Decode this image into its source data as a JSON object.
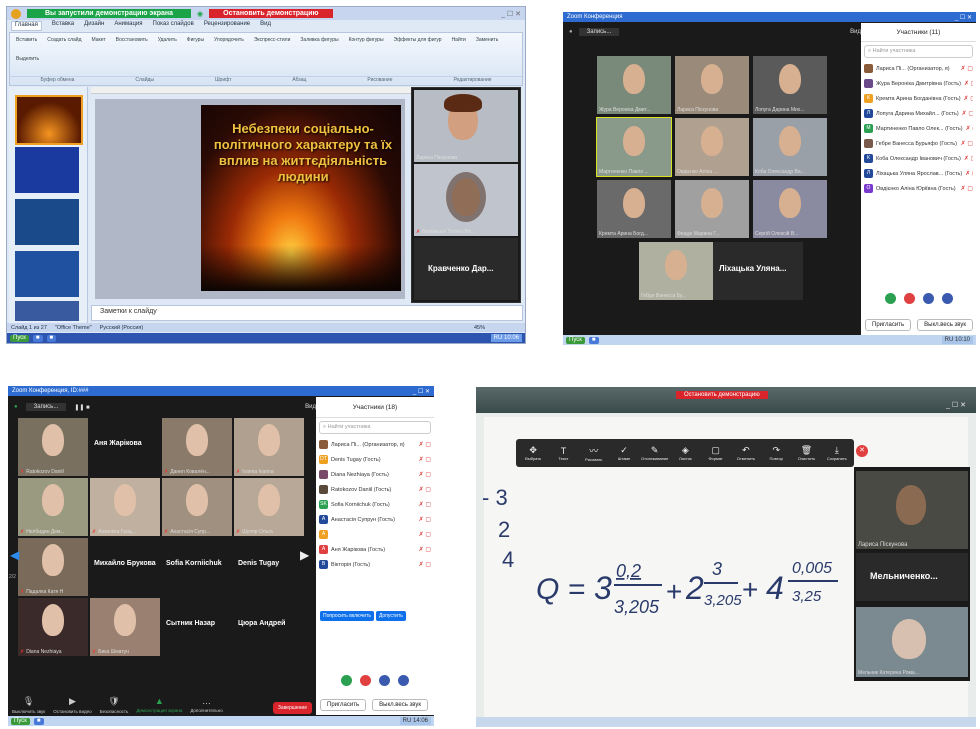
{
  "colors": {
    "ppt_title_bar": "#24399b",
    "demo_green": "#1aa447",
    "stop_red": "#d9242c",
    "zoom_dark": "#1a1a1a",
    "zoom_blue": "#0e71eb",
    "slide_gold": "#f0c040"
  },
  "q1": {
    "demo_banner": "Вы запустили демонстрацию экрана",
    "stop_demo": "Остановить демонстрацию",
    "ribbon_tabs": [
      "Главная",
      "Вставка",
      "Дизайн",
      "Анимация",
      "Показ слайдов",
      "Рецензирование",
      "Вид"
    ],
    "ribbon_groups": [
      "Буфер обмена",
      "Слайды",
      "Шрифт",
      "Абзац",
      "Рисование",
      "Редактирование"
    ],
    "ribbon_buttons": [
      "Вставить",
      "Создать слайд",
      "Макет",
      "Восстановить",
      "Удалить",
      "Фигуры",
      "Упорядочить",
      "Экспресс-стили",
      "Заливка фигуры",
      "Контур фигуры",
      "Эффекты для фигур",
      "Найти",
      "Заменить",
      "Выделить"
    ],
    "slide_title": "Небезпеки соціально-політичного характеру та їх вплив на життєдіяльність людини",
    "participant1": "Лариса Піскунова",
    "participant2": "Веремьюк Тетяна Віт...",
    "participant3": "Кравченко Дар...",
    "notes": "Заметки к слайду",
    "status": "Слайд 1 из 27",
    "theme": "\"Office Theme\"",
    "lang": "Русский (Россия)",
    "zoom": "45%",
    "start": "Пуск",
    "lang_tray": "RU",
    "time": "10:06"
  },
  "q2": {
    "title": "Zoom Конференция",
    "record": "Запись...",
    "view": "Вид",
    "participants_header": "Участники (11)",
    "search": "Найти участника",
    "tiles": [
      "Жура Вероніка Дмит...",
      "Лариса Піскунова",
      "Лопуга Дарина Мих...",
      "Мартиненко Павло ...",
      "Овдієнко Аліна ...",
      "Коба Олександр Ва...",
      "Кремта Арина Богд...",
      "Фещук Марина Г...",
      "Сергій Олексій В...",
      "Гебре Ванесса Бу...",
      "Ліхацька Уляна..."
    ],
    "participants": [
      {
        "name": "Лариса Пі... (Организатор, я)",
        "color": "#8a5a3a",
        "letter": ""
      },
      {
        "name": "Жура Вероніка Дмитрівна (Гость)",
        "color": "#6a4a8a",
        "letter": ""
      },
      {
        "name": "Кремта Арина Богданівна (Гость)",
        "color": "#f0a020",
        "letter": "К"
      },
      {
        "name": "Лопуга Дарина Михайл... (Гость)",
        "color": "#234a9a",
        "letter": "Л"
      },
      {
        "name": "Мартиненко Павло Олек... (Гость)",
        "color": "#2aa050",
        "letter": "М"
      },
      {
        "name": "Гебре Ванесса Бурьяфо (Гость)",
        "color": "#7a5a4a",
        "letter": ""
      },
      {
        "name": "Коба Олександр Іванович (Гость)",
        "color": "#234a9a",
        "letter": "К"
      },
      {
        "name": "Ліхацька Уляна Ярослав... (Гость)",
        "color": "#234a9a",
        "letter": "Л"
      },
      {
        "name": "Овдієнко Аліна Юріївна (Гость)",
        "color": "#7a3ad0",
        "letter": "О"
      }
    ],
    "invite": "Пригласить",
    "mute_all": "Выкл.весь звук",
    "start": "Пуск",
    "tray_lang": "RU",
    "time": "10:10"
  },
  "q3": {
    "title": "Zoom Конференция, ID:###",
    "record": "Запись...",
    "view": "Вид",
    "participants_header": "Участники (18)",
    "search": "Найти участника",
    "tiles": [
      {
        "name": "Ratokozov Daniil",
        "big": "",
        "video": true
      },
      {
        "name": "",
        "big": "Аня Жарікова",
        "video": false
      },
      {
        "name": "Данил Ковалён...",
        "big": "",
        "video": true
      },
      {
        "name": "Ivanna Ivanna",
        "big": "",
        "video": true
      },
      {
        "name": "Нелбидин Дем...",
        "big": "",
        "video": true
      },
      {
        "name": "Анжеліка Гаоц...",
        "big": "",
        "video": true
      },
      {
        "name": "Анастасія Супр...",
        "big": "",
        "video": true
      },
      {
        "name": "Шуляр Ольга",
        "big": "",
        "video": true
      },
      {
        "name": "Падалка Катя Н",
        "big": "",
        "video": true
      },
      {
        "name": "",
        "big": "Михайло Брукова",
        "video": false
      },
      {
        "name": "",
        "big": "Sofia Korniichuk",
        "video": false
      },
      {
        "name": "",
        "big": "Denis Tugay",
        "video": false
      },
      {
        "name": "Diana Nezhiaya",
        "big": "",
        "video": true
      },
      {
        "name": "Бикa Шматун",
        "big": "",
        "video": true
      },
      {
        "name": "",
        "big": "Сытник Назар",
        "video": false
      },
      {
        "name": "",
        "big": "Цюра Андрей",
        "video": false
      }
    ],
    "page_indicator": "2/2",
    "participants": [
      {
        "name": "Лариса Пі... (Организатор, я)",
        "color": "#8a5a3a",
        "letter": ""
      },
      {
        "name": "Denis Tugay (Гость)",
        "color": "#f0a020",
        "letter": "DT"
      },
      {
        "name": "Diana Nezhiaya (Гость)",
        "color": "#7a4a6a",
        "letter": ""
      },
      {
        "name": "Ratokozov Daniil (Гость)",
        "color": "#5a4a3a",
        "letter": ""
      },
      {
        "name": "Sofia Korniichuk (Гость)",
        "color": "#2aa050",
        "letter": "SK"
      },
      {
        "name": "Анастасія Супрун (Гость)",
        "color": "#234a9a",
        "letter": "А"
      },
      {
        "name": "",
        "color": "#f0a020",
        "letter": "А"
      },
      {
        "name": "Аня Жарікова (Гость)",
        "color": "#e04040",
        "letter": "А"
      },
      {
        "name": "Вікторія (Гость)",
        "color": "#234a9a",
        "letter": "В"
      }
    ],
    "ask_unmute": "Попросить включить",
    "admit": "Допустить",
    "controls": [
      "Выключить звук",
      "Остановить видео",
      "Безопасность",
      "Демонстрация экрана",
      "Дополнительно"
    ],
    "end": "Завершение",
    "invite": "Пригласить",
    "mute_all": "Выкл.весь звук",
    "start": "Пуск",
    "tray_lang": "RU",
    "time": "14:06"
  },
  "q4": {
    "stop_demo": "Остановить демонстрацию",
    "tools": [
      "Выбрать",
      "Текст",
      "Рисовать",
      "Штамп",
      "Отслеживание",
      "Ластик",
      "Формат",
      "Отменить",
      "Повтор",
      "Очистить",
      "Сохранить"
    ],
    "participant1": "Лариса Піскунова",
    "participant2": "Мельниченко...",
    "participant3": "Мельник Катерина Рома...",
    "margin_numbers": [
      "- 3",
      "2",
      "4"
    ],
    "formula": {
      "lhs": "Q = ",
      "t1_whole": "3",
      "t1_num": "0,2",
      "t1_den": "3,205",
      "t2_whole": "2",
      "t2_num": "3",
      "t2_den": "3,205",
      "t3_whole": "4",
      "t3_num": "0,005",
      "t3_den": "3,25"
    }
  }
}
